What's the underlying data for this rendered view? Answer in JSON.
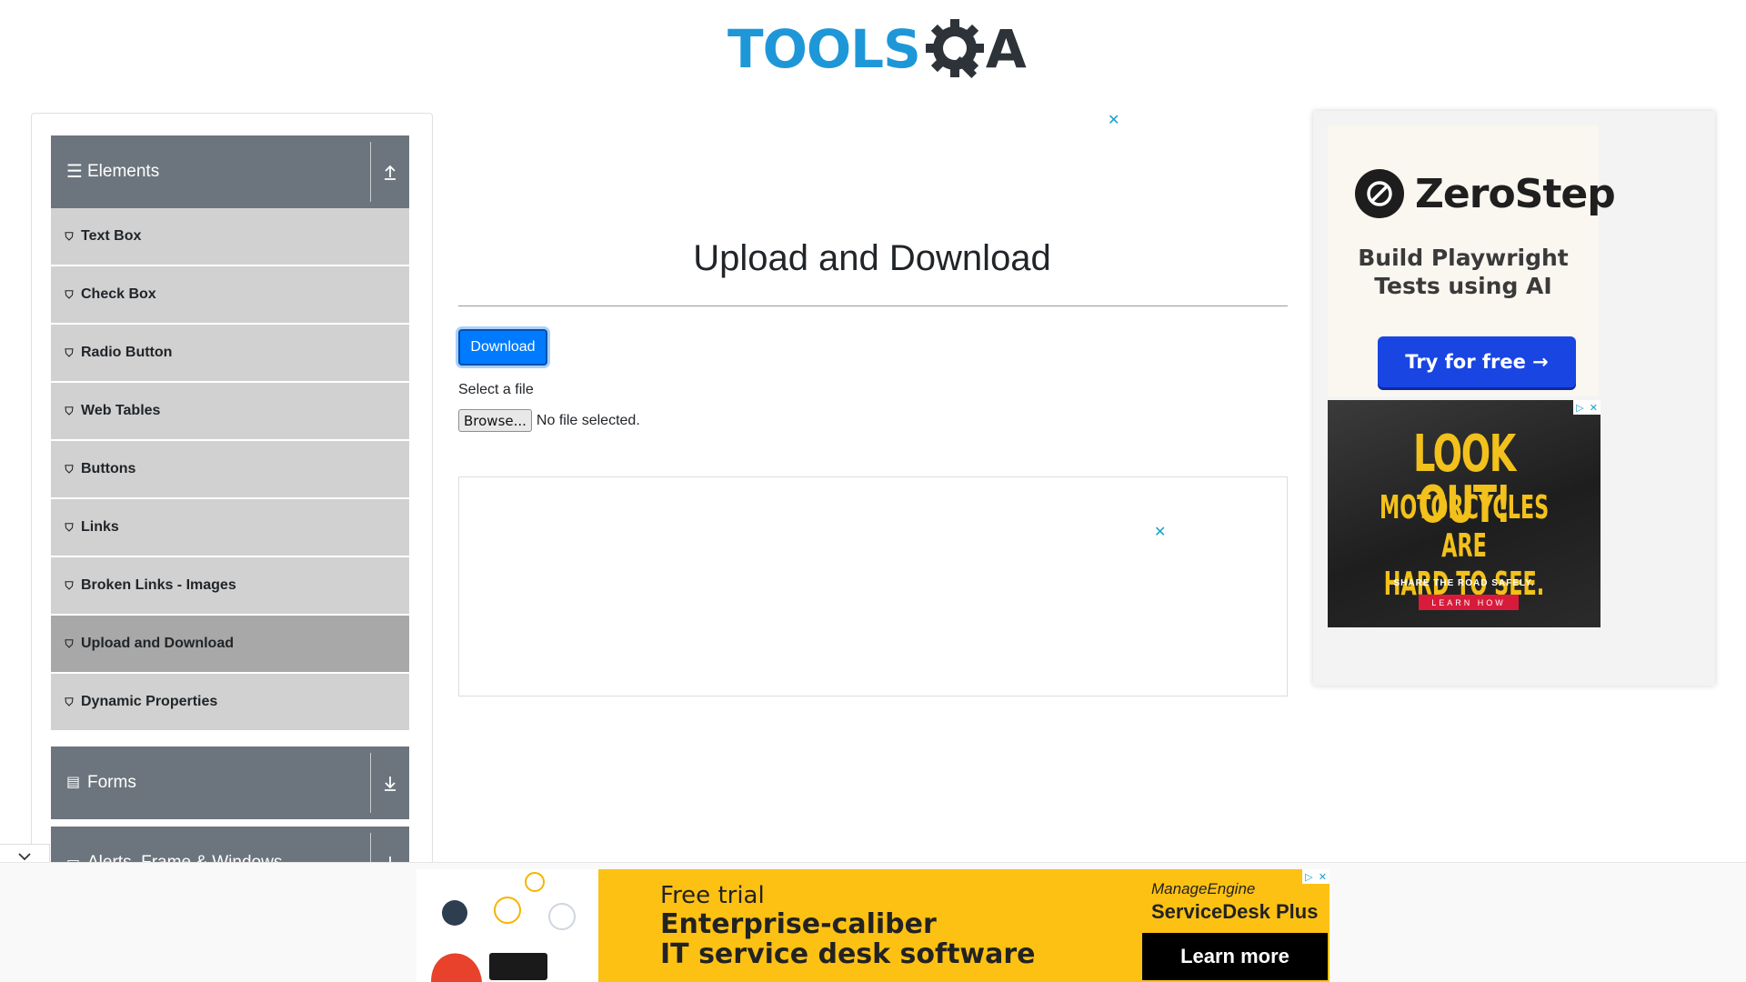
{
  "logo": {
    "part1": "TOOLS",
    "part2": "A"
  },
  "sidebar": {
    "elements_header": {
      "title": "Elements",
      "icon": "hamburger-icon",
      "toggle_icon": "upload-arrow-icon"
    },
    "items": [
      {
        "label": "Text Box"
      },
      {
        "label": "Check Box"
      },
      {
        "label": "Radio Button"
      },
      {
        "label": "Web Tables"
      },
      {
        "label": "Buttons"
      },
      {
        "label": "Links"
      },
      {
        "label": "Broken Links - Images"
      },
      {
        "label": "Upload and Download"
      },
      {
        "label": "Dynamic Properties"
      }
    ],
    "active_item": "Upload and Download",
    "forms_header": {
      "title": "Forms",
      "icon": "form-icon",
      "toggle_icon": "download-arrow-icon"
    },
    "alerts_header": {
      "title": "Alerts, Frame & Windows",
      "icon": "window-icon",
      "toggle_icon": "download-arrow-icon"
    }
  },
  "main": {
    "title": "Upload and Download",
    "download_label": "Download",
    "file_label": "Select a file",
    "browse_label": "Browse...",
    "no_file_text": "No file selected."
  },
  "right_ad": {
    "brand": "ZeroStep",
    "tagline_line1": "Build Playwright",
    "tagline_line2": "Tests using AI",
    "cta": "Try for free →",
    "moto_headline": "LOOK OUT!",
    "moto_line2": "MOTORCYCLES ARE",
    "moto_line3": "HARD TO SEE.",
    "moto_sub": "SHARE THE ROAD SAFELY.",
    "moto_cta": "LEARN HOW"
  },
  "bottom_ad": {
    "line1": "Free trial",
    "line2": "Enterprise-caliber",
    "line3": "IT service desk software",
    "brand1": "ManageEngine",
    "brand2": "ServiceDesk Plus",
    "cta": "Learn more"
  },
  "colors": {
    "accent": "#007bff",
    "sidebar_header": "#6c757d",
    "menu_item": "#d1d1d1",
    "menu_item_active": "#a8a8a8",
    "logo_blue": "#1e97d8",
    "ad_yellow": "#fdc114"
  }
}
